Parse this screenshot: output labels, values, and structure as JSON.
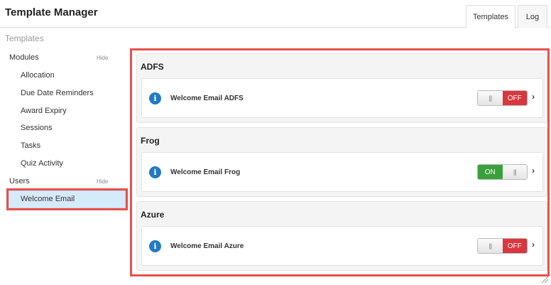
{
  "header": {
    "title": "Template Manager",
    "tabs": [
      {
        "label": "Templates",
        "active": true
      },
      {
        "label": "Log",
        "active": false
      }
    ]
  },
  "subheader": {
    "title": "Templates"
  },
  "sidebar": {
    "groups": [
      {
        "label": "Modules",
        "hide_label": "Hide",
        "items": [
          {
            "label": "Allocation"
          },
          {
            "label": "Due Date Reminders"
          },
          {
            "label": "Award Expiry"
          },
          {
            "label": "Sessions"
          },
          {
            "label": "Tasks"
          },
          {
            "label": "Quiz Activity"
          }
        ]
      },
      {
        "label": "Users",
        "hide_label": "Hide",
        "items": [
          {
            "label": "Welcome Email",
            "selected": true
          }
        ]
      }
    ]
  },
  "sections": [
    {
      "title": "ADFS",
      "card": {
        "label": "Welcome Email ADFS",
        "toggle_state": "OFF",
        "toggle_knob": "|||"
      }
    },
    {
      "title": "Frog",
      "card": {
        "label": "Welcome Email Frog",
        "toggle_state": "ON",
        "toggle_knob": "|||"
      }
    },
    {
      "title": "Azure",
      "card": {
        "label": "Welcome Email Azure",
        "toggle_state": "OFF",
        "toggle_knob": "|||"
      }
    }
  ],
  "icons": {
    "info": "i",
    "chevron": "›"
  },
  "colors": {
    "highlight_border": "#e8514a",
    "toggle_off": "#d9363e",
    "toggle_on": "#3aa13a",
    "info_icon": "#2279c4",
    "selected_bg": "#d6ebfa"
  }
}
